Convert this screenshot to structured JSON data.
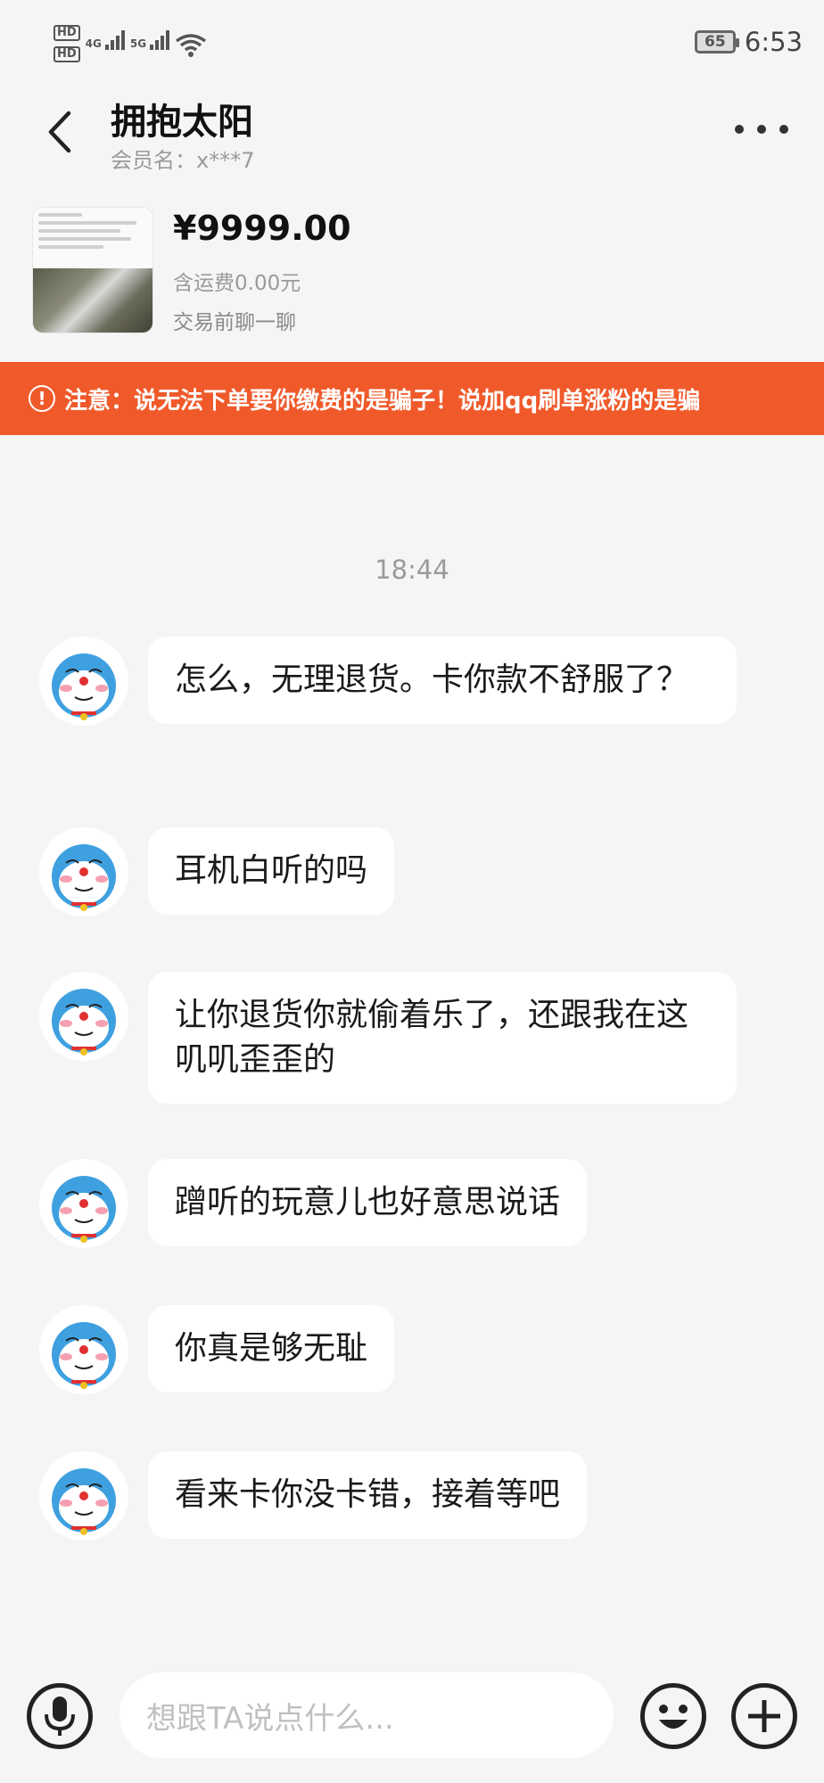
{
  "status_bar": {
    "hd1": "HD",
    "hd2": "HD",
    "net1": "4G",
    "net2": "5G",
    "battery": "65",
    "time": "6:53"
  },
  "header": {
    "back_icon": "chevron-left-icon",
    "title": "拥抱太阳",
    "member": "会员名：x***7",
    "more_icon": "more-dots-icon"
  },
  "product": {
    "price": "¥9999.00",
    "shipping": "含运费0.00元",
    "chat_first": "交易前聊一聊"
  },
  "warning": {
    "icon": "alert-circle-icon",
    "text": "注意：说无法下单要你缴费的是骗子！说加qq刷单涨粉的是骗"
  },
  "chat": {
    "timestamp": "18:44",
    "messages": [
      {
        "text": "怎么，无理退货。卡你款不舒服了？"
      },
      {
        "text": "耳机白听的吗"
      },
      {
        "text": "让你退货你就偷着乐了，还跟我在这叽叽歪歪的"
      },
      {
        "text": "蹭听的玩意儿也好意思说话"
      },
      {
        "text": "你真是够无耻"
      },
      {
        "text": "看来卡你没卡错，接着等吧"
      }
    ]
  },
  "input": {
    "placeholder": "想跟TA说点什么..."
  },
  "colors": {
    "warning_bg": "#f05a2b",
    "background": "#f5f5f5"
  }
}
